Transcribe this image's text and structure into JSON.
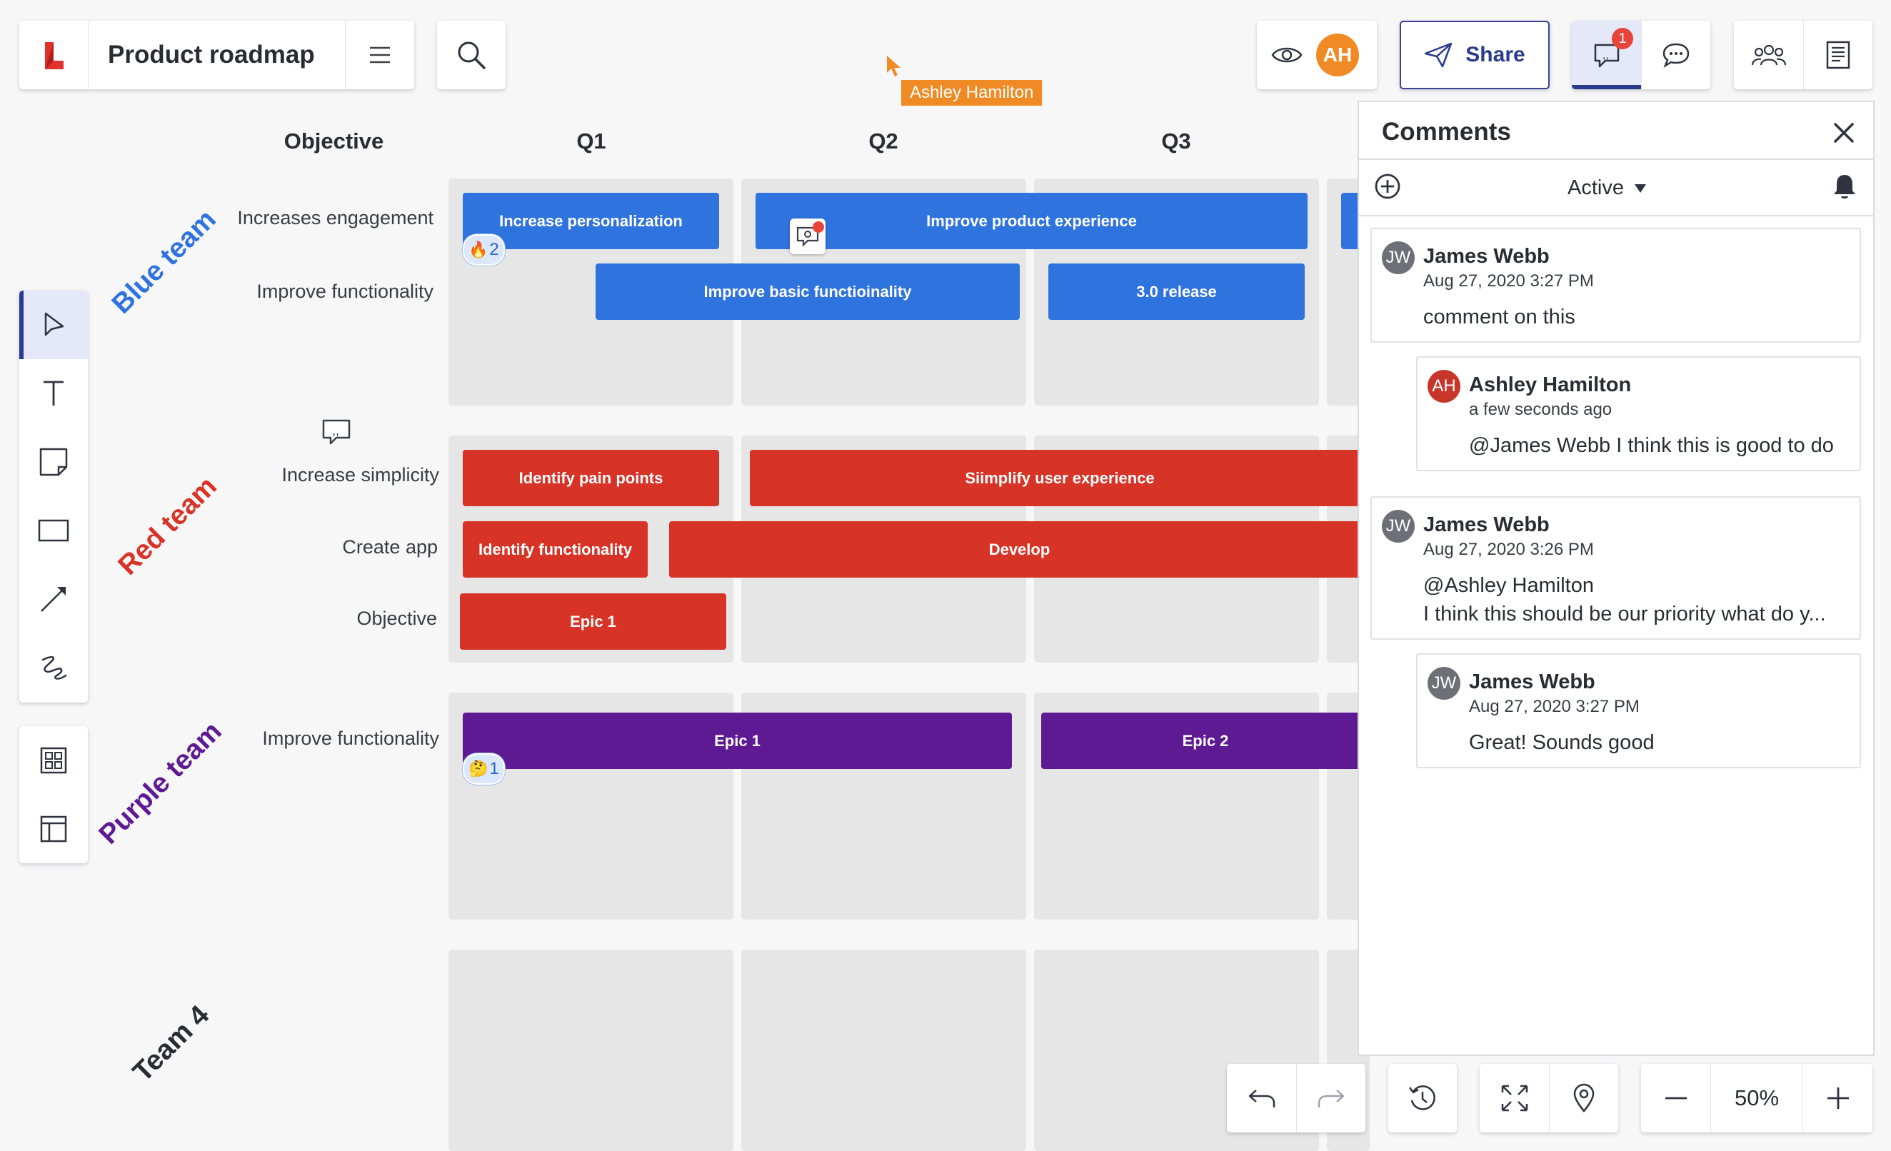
{
  "document": {
    "title": "Product roadmap"
  },
  "colors": {
    "accent": "#2f73de",
    "blue_team": "#2f73de",
    "red_team": "#d83327",
    "purple_team": "#5e1a92",
    "brand": "#e1312a",
    "presence": "#f08a24",
    "share_border": "#3a3f9c"
  },
  "header": {
    "share_label": "Share",
    "user_initials": "AH",
    "notification_count": "1",
    "cursor_label": "Ashley Hamilton"
  },
  "board": {
    "objective_header": "Objective",
    "quarters": [
      "Q1",
      "Q2",
      "Q3"
    ],
    "teams": [
      {
        "name": "Blue team",
        "rows": [
          "Increases engagement",
          "Improve functionality"
        ]
      },
      {
        "name": "Red team",
        "rows": [
          "Increase simplicity",
          "Create app",
          "Objective"
        ]
      },
      {
        "name": "Purple team",
        "rows": [
          "Improve functionality"
        ]
      },
      {
        "name": "Team 4",
        "rows": []
      }
    ],
    "bars": {
      "increase_personalization": "Increase personalization",
      "improve_product_experience": "Improve product experience",
      "improve_basic_functionality": "Improve basic functioinality",
      "release_3": "3.0 release",
      "identify_pain_points": "Identify pain points",
      "simplify_user_experience": "Siimplify user experience",
      "identify_functionality": "Identify functionality",
      "develop": "Develop",
      "epic_1_red": "Epic 1",
      "epic_1_purple": "Epic 1",
      "epic_2_purple": "Epic 2"
    },
    "reactions": [
      {
        "emoji": "🔥",
        "count": "2"
      },
      {
        "emoji": "🤔",
        "count": "1"
      }
    ]
  },
  "comments_panel": {
    "title": "Comments",
    "filter": "Active",
    "threads": [
      {
        "initials": "JW",
        "author": "James Webb",
        "date": "Aug 27, 2020 3:27 PM",
        "text": "comment on this",
        "avatar_color": "#6e7078"
      },
      {
        "initials": "AH",
        "author": "Ashley Hamilton",
        "date": "a few seconds ago",
        "text": "@James Webb I think this is good to do",
        "avatar_color": "#c8352a"
      },
      {
        "initials": "JW",
        "author": "James Webb",
        "date": "Aug 27, 2020 3:26 PM",
        "text_line1": "@Ashley Hamilton",
        "text_line2": "I think this should be our priority what do y...",
        "avatar_color": "#6e7078"
      },
      {
        "initials": "JW",
        "author": "James Webb",
        "date": "Aug 27, 2020 3:27 PM",
        "text": "Great! Sounds good",
        "avatar_color": "#6e7078"
      }
    ]
  },
  "bottom_toolbar": {
    "zoom": "50%"
  },
  "icons": [
    "lucid-logo-icon",
    "hamburger-menu-icon",
    "search-icon",
    "eye-icon",
    "share-send-icon",
    "comment-notification-icon",
    "chat-bubble-icon",
    "collaborators-icon",
    "notes-icon",
    "select-arrow-icon",
    "text-tool-icon",
    "sticky-note-icon",
    "rectangle-icon",
    "line-arrow-icon",
    "freehand-icon",
    "shape-library-icon",
    "template-icon",
    "add-comment-icon",
    "bell-icon",
    "close-icon",
    "undo-icon",
    "redo-icon",
    "history-icon",
    "fit-to-screen-icon",
    "location-pin-icon",
    "zoom-out-icon",
    "zoom-in-icon"
  ]
}
